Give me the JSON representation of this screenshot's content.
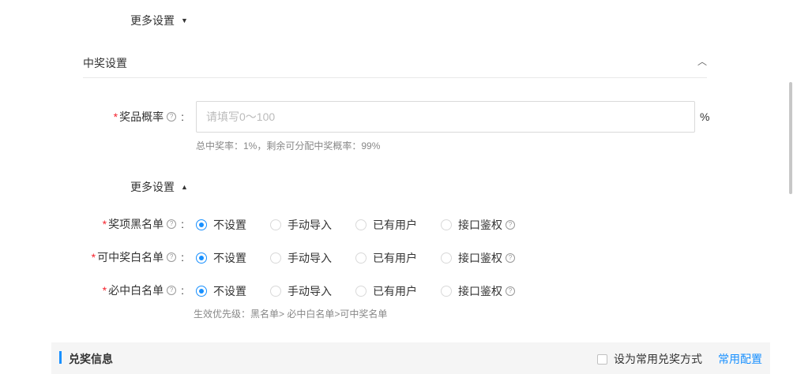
{
  "top_more": {
    "label": "更多设置"
  },
  "prize_section": {
    "title": "中奖设置"
  },
  "probability": {
    "label": "奖品概率",
    "placeholder": "请填写0～100",
    "unit": "%",
    "hint": "总中奖率：1%，剩余可分配中奖概率：99%"
  },
  "more_settings": {
    "label": "更多设置"
  },
  "radio_options": [
    "不设置",
    "手动导入",
    "已有用户",
    "接口鉴权"
  ],
  "rows": [
    {
      "label": "奖项黑名单",
      "selected": 0
    },
    {
      "label": "可中奖白名单",
      "selected": 0
    },
    {
      "label": "必中白名单",
      "selected": 0
    }
  ],
  "priority_hint": "生效优先级：黑名单> 必中白名单>可中奖名单",
  "redeem": {
    "title": "兑奖信息",
    "checkbox_label": "设为常用兑奖方式",
    "link": "常用配置"
  },
  "colors": {
    "accent": "#1890ff",
    "required": "#f5222d"
  }
}
